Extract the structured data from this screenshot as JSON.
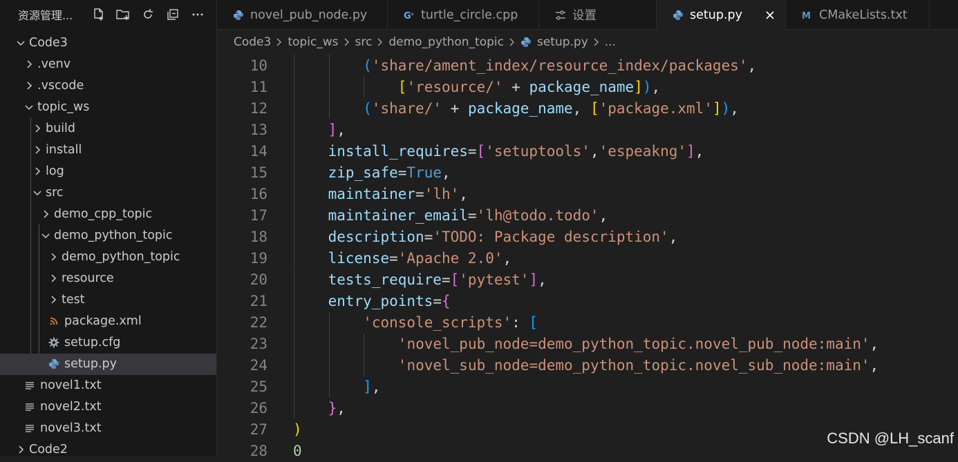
{
  "sidebar": {
    "title": "资源管理...",
    "actions": [
      "new-file-icon",
      "new-folder-icon",
      "refresh-icon",
      "collapse-all-icon",
      "more-icon"
    ],
    "tree": [
      {
        "label": "Code3",
        "depth": 0,
        "kind": "folder",
        "state": "open"
      },
      {
        "label": ".venv",
        "depth": 1,
        "kind": "folder",
        "state": "closed"
      },
      {
        "label": ".vscode",
        "depth": 1,
        "kind": "folder",
        "state": "closed"
      },
      {
        "label": "topic_ws",
        "depth": 1,
        "kind": "folder",
        "state": "open"
      },
      {
        "label": "build",
        "depth": 2,
        "kind": "folder",
        "state": "closed"
      },
      {
        "label": "install",
        "depth": 2,
        "kind": "folder",
        "state": "closed"
      },
      {
        "label": "log",
        "depth": 2,
        "kind": "folder",
        "state": "closed"
      },
      {
        "label": "src",
        "depth": 2,
        "kind": "folder",
        "state": "open"
      },
      {
        "label": "demo_cpp_topic",
        "depth": 3,
        "kind": "folder",
        "state": "closed"
      },
      {
        "label": "demo_python_topic",
        "depth": 3,
        "kind": "folder",
        "state": "open"
      },
      {
        "label": "demo_python_topic",
        "depth": 4,
        "kind": "folder",
        "state": "closed"
      },
      {
        "label": "resource",
        "depth": 4,
        "kind": "folder",
        "state": "closed"
      },
      {
        "label": "test",
        "depth": 4,
        "kind": "folder",
        "state": "closed"
      },
      {
        "label": "package.xml",
        "depth": 4,
        "kind": "file",
        "icon": "rss-icon"
      },
      {
        "label": "setup.cfg",
        "depth": 4,
        "kind": "file",
        "icon": "gear-icon"
      },
      {
        "label": "setup.py",
        "depth": 4,
        "kind": "file",
        "icon": "python-icon",
        "selected": true
      },
      {
        "label": "novel1.txt",
        "depth": 1,
        "kind": "file",
        "icon": "text-file-icon"
      },
      {
        "label": "novel2.txt",
        "depth": 1,
        "kind": "file",
        "icon": "text-file-icon"
      },
      {
        "label": "novel3.txt",
        "depth": 1,
        "kind": "file",
        "icon": "text-file-icon"
      },
      {
        "label": "Code2",
        "depth": 0,
        "kind": "folder",
        "state": "closed"
      }
    ]
  },
  "tabs": [
    {
      "label": "novel_pub_node.py",
      "icon": "python-icon",
      "active": false
    },
    {
      "label": "turtle_circle.cpp",
      "icon": "cpp-icon",
      "active": false
    },
    {
      "label": "设置",
      "icon": "settings-icon",
      "active": false
    },
    {
      "label": "setup.py",
      "icon": "python-icon",
      "active": true
    },
    {
      "label": "CMakeLists.txt",
      "icon": "cmake-icon",
      "active": false
    }
  ],
  "breadcrumb": [
    "Code3",
    "topic_ws",
    "src",
    "demo_python_topic",
    "setup.py",
    "..."
  ],
  "editor": {
    "lines": [
      {
        "n": "10",
        "indent": 2,
        "tokens": [
          [
            "b3",
            "("
          ],
          [
            "t-str",
            "'share/ament_index/resource_index/packages'"
          ],
          [
            "t-op",
            ","
          ]
        ]
      },
      {
        "n": "11",
        "indent": 3,
        "tokens": [
          [
            "b1",
            "["
          ],
          [
            "t-str",
            "'resource/'"
          ],
          [
            "t-op",
            " + "
          ],
          [
            "t-var",
            "package_name"
          ],
          [
            "b1",
            "]"
          ],
          [
            "b3",
            ")"
          ],
          [
            "t-op",
            ","
          ]
        ]
      },
      {
        "n": "12",
        "indent": 2,
        "tokens": [
          [
            "b3",
            "("
          ],
          [
            "t-str",
            "'share/'"
          ],
          [
            "t-op",
            " + "
          ],
          [
            "t-var",
            "package_name"
          ],
          [
            "t-op",
            ", "
          ],
          [
            "b1",
            "["
          ],
          [
            "t-str",
            "'package.xml'"
          ],
          [
            "b1",
            "]"
          ],
          [
            "b3",
            ")"
          ],
          [
            "t-op",
            ","
          ]
        ]
      },
      {
        "n": "13",
        "indent": 1,
        "tokens": [
          [
            "b2",
            "]"
          ],
          [
            "t-op",
            ","
          ]
        ]
      },
      {
        "n": "14",
        "indent": 1,
        "tokens": [
          [
            "t-var",
            "install_requires"
          ],
          [
            "t-op",
            "="
          ],
          [
            "b2",
            "["
          ],
          [
            "t-str",
            "'setuptools'"
          ],
          [
            "t-op",
            ","
          ],
          [
            "t-str",
            "'espeakng'"
          ],
          [
            "b2",
            "]"
          ],
          [
            "t-op",
            ","
          ]
        ]
      },
      {
        "n": "15",
        "indent": 1,
        "tokens": [
          [
            "t-var",
            "zip_safe"
          ],
          [
            "t-op",
            "="
          ],
          [
            "t-kw",
            "True"
          ],
          [
            "t-op",
            ","
          ]
        ]
      },
      {
        "n": "16",
        "indent": 1,
        "tokens": [
          [
            "t-var",
            "maintainer"
          ],
          [
            "t-op",
            "="
          ],
          [
            "t-str",
            "'lh'"
          ],
          [
            "t-op",
            ","
          ]
        ]
      },
      {
        "n": "17",
        "indent": 1,
        "tokens": [
          [
            "t-var",
            "maintainer_email"
          ],
          [
            "t-op",
            "="
          ],
          [
            "t-str",
            "'lh@todo.todo'"
          ],
          [
            "t-op",
            ","
          ]
        ]
      },
      {
        "n": "18",
        "indent": 1,
        "tokens": [
          [
            "t-var",
            "description"
          ],
          [
            "t-op",
            "="
          ],
          [
            "t-str",
            "'TODO: Package description'"
          ],
          [
            "t-op",
            ","
          ]
        ]
      },
      {
        "n": "19",
        "indent": 1,
        "tokens": [
          [
            "t-var",
            "license"
          ],
          [
            "t-op",
            "="
          ],
          [
            "t-str",
            "'Apache 2.0'"
          ],
          [
            "t-op",
            ","
          ]
        ]
      },
      {
        "n": "20",
        "indent": 1,
        "tokens": [
          [
            "t-var",
            "tests_require"
          ],
          [
            "t-op",
            "="
          ],
          [
            "b2",
            "["
          ],
          [
            "t-str",
            "'pytest'"
          ],
          [
            "b2",
            "]"
          ],
          [
            "t-op",
            ","
          ]
        ]
      },
      {
        "n": "21",
        "indent": 1,
        "tokens": [
          [
            "t-var",
            "entry_points"
          ],
          [
            "t-op",
            "="
          ],
          [
            "b2",
            "{"
          ]
        ]
      },
      {
        "n": "22",
        "indent": 2,
        "tokens": [
          [
            "t-str",
            "'console_scripts'"
          ],
          [
            "t-op",
            ": "
          ],
          [
            "b3",
            "["
          ]
        ]
      },
      {
        "n": "23",
        "indent": 3,
        "tokens": [
          [
            "t-str",
            "'novel_pub_node=demo_python_topic.novel_pub_node:main'"
          ],
          [
            "t-op",
            ","
          ]
        ]
      },
      {
        "n": "24",
        "indent": 3,
        "tokens": [
          [
            "t-str",
            "'novel_sub_node=demo_python_topic.novel_sub_node:main'"
          ],
          [
            "t-op",
            ","
          ]
        ]
      },
      {
        "n": "25",
        "indent": 2,
        "tokens": [
          [
            "b3",
            "]"
          ],
          [
            "t-op",
            ","
          ]
        ]
      },
      {
        "n": "26",
        "indent": 1,
        "tokens": [
          [
            "b2",
            "}"
          ],
          [
            "t-op",
            ","
          ]
        ]
      },
      {
        "n": "27",
        "indent": 0,
        "tokens": [
          [
            "b1",
            ")"
          ]
        ]
      },
      {
        "n": "28",
        "indent": 0,
        "tokens": [
          [
            "t-num",
            "0"
          ]
        ]
      }
    ]
  },
  "watermark": "CSDN @LH_scanf"
}
